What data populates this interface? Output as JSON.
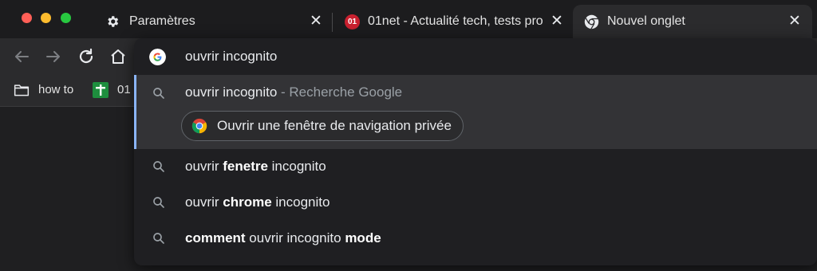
{
  "window": {
    "traffic_lights": [
      "close",
      "minimize",
      "zoom"
    ],
    "colors": {
      "red": "#ff5f57",
      "yellow": "#febc2e",
      "green": "#28c840",
      "accent": "#8ab4f8"
    }
  },
  "tabs": [
    {
      "title": "Paramètres",
      "icon": "gear-icon",
      "close": "✕"
    },
    {
      "title": "01net - Actualité tech, tests pro",
      "icon": "01net-favicon",
      "favicon_text": "01",
      "close": "✕"
    },
    {
      "title": "Nouvel onglet",
      "icon": "chrome-icon",
      "close": "✕",
      "active": true
    }
  ],
  "toolbar": {
    "buttons": [
      "back-icon",
      "forward-icon",
      "reload-icon",
      "home-icon"
    ]
  },
  "bookmarks": [
    {
      "label": "how to",
      "icon": "folder-icon"
    },
    {
      "label": "01",
      "icon": "sheets-icon"
    }
  ],
  "omnibox": {
    "value": "ouvrir incognito",
    "selected_suggestion": {
      "text": "ouvrir incognito",
      "description": " - Recherche Google"
    },
    "action_chip": "Ouvrir une fenêtre de navigation privée",
    "suggestions": [
      {
        "parts": [
          "ouvrir ",
          "fenetre",
          " incognito"
        ]
      },
      {
        "parts": [
          "ouvrir ",
          "chrome",
          " incognito"
        ]
      },
      {
        "parts": [
          "comment",
          " ouvrir incognito ",
          "mode"
        ]
      }
    ]
  }
}
